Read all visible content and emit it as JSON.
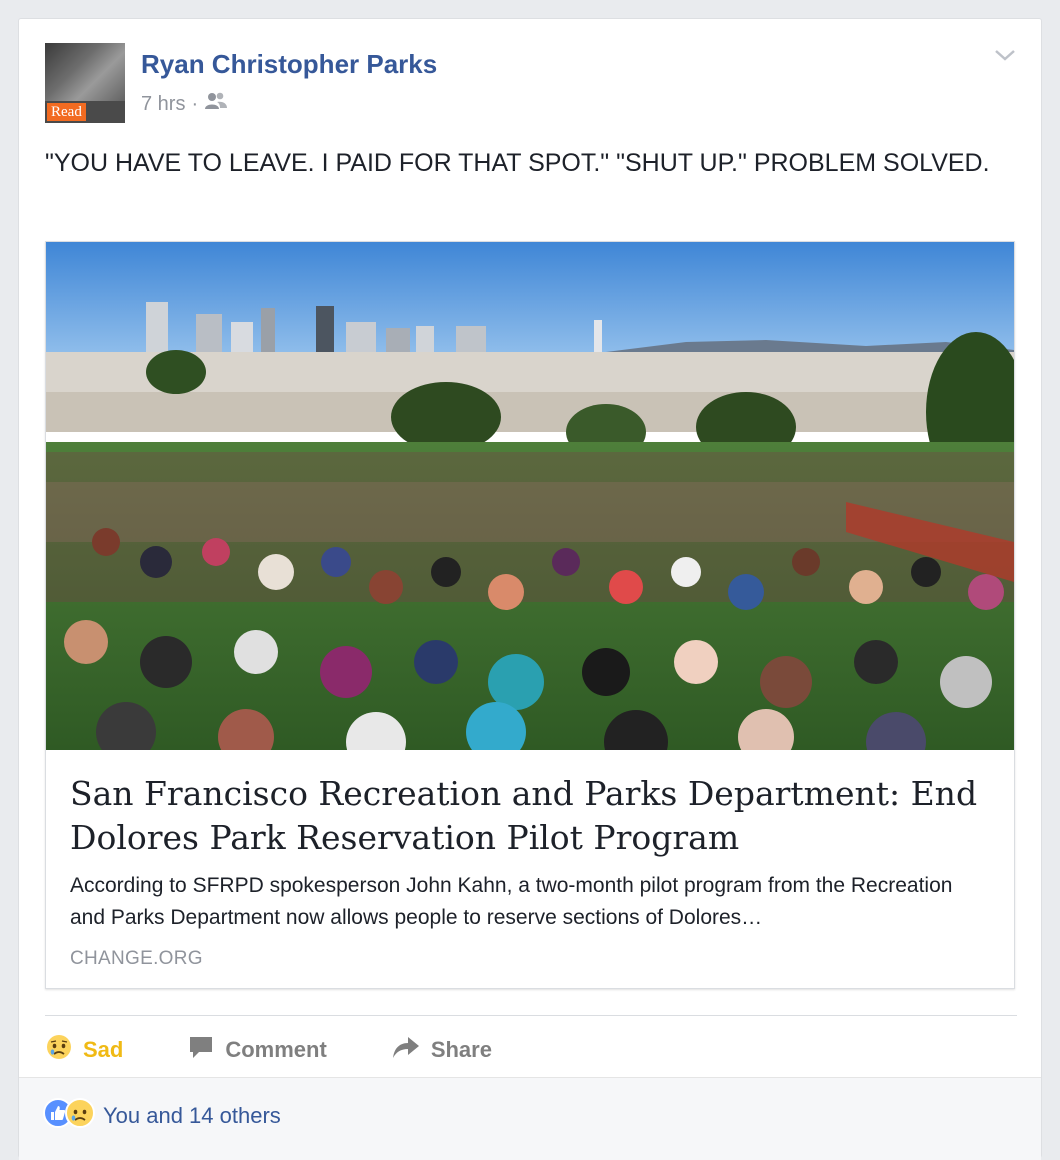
{
  "post": {
    "author": "Ryan Christopher Parks",
    "time": "7 hrs",
    "privacy_icon": "friends-icon",
    "avatar_badge": "Read",
    "text": "\"YOU HAVE TO LEAVE. I PAID FOR THAT SPOT.\" \"SHUT UP.\" PROBLEM SOLVED."
  },
  "link": {
    "title": "San Francisco Recreation and Parks Department: End Dolores Park Reservation Pilot Program",
    "description": "According to SFRPD spokesperson John Kahn, a two-month pilot program from the Recreation and Parks Department now allows people to reserve sections of Dolores…",
    "domain": "CHANGE.ORG"
  },
  "actions": {
    "sad_label": "Sad",
    "comment_label": "Comment",
    "share_label": "Share"
  },
  "reactions": {
    "summary": "You and 14 others",
    "icons": [
      "like-icon",
      "sad-icon"
    ]
  },
  "colors": {
    "link_blue": "#365899",
    "sad_yellow": "#f0ba15",
    "meta_gray": "#90949c"
  }
}
